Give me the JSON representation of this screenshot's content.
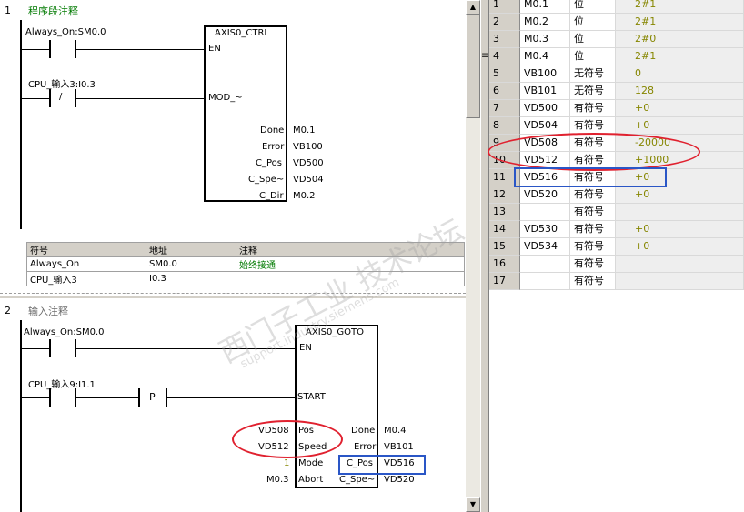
{
  "network1": {
    "number": "1",
    "comment": "程序段注释",
    "contact1_label": "Always_On:SM0.0",
    "contact2_label": "CPU_输入3:I0.3",
    "contact2_symbol": "/",
    "block_title": "AXIS0_CTRL",
    "in_en": "EN",
    "in_mod": "MOD_~",
    "outputs": [
      {
        "pin": "Done",
        "addr": "M0.1"
      },
      {
        "pin": "Error",
        "addr": "VB100"
      },
      {
        "pin": "C_Pos",
        "addr": "VD500"
      },
      {
        "pin": "C_Spe~",
        "addr": "VD504"
      },
      {
        "pin": "C_Dir",
        "addr": "M0.2"
      }
    ],
    "symbol_table": {
      "headers": [
        "符号",
        "地址",
        "注释"
      ],
      "rows": [
        [
          "Always_On",
          "SM0.0",
          "始终接通"
        ],
        [
          "CPU_输入3",
          "I0.3",
          ""
        ]
      ]
    }
  },
  "network2": {
    "number": "2",
    "comment": "输入注释",
    "contact1_label": "Always_On:SM0.0",
    "contact2_label": "CPU_输入9:I1.1",
    "edge_symbol": "P",
    "block_title": "AXIS0_GOTO",
    "in_en": "EN",
    "in_start": "START",
    "inputs": [
      {
        "addr": "VD508",
        "pin": "Pos"
      },
      {
        "addr": "VD512",
        "pin": "Speed"
      },
      {
        "addr": "1",
        "pin": "Mode"
      },
      {
        "addr": "M0.3",
        "pin": "Abort"
      }
    ],
    "outputs": [
      {
        "pin": "Done",
        "addr": "M0.4"
      },
      {
        "pin": "Error",
        "addr": "VB101"
      },
      {
        "pin": "C_Pos",
        "addr": "VD516"
      },
      {
        "pin": "C_Spe~",
        "addr": "VD520"
      }
    ]
  },
  "scrollbar": {
    "up": "▲",
    "down": "▼",
    "grip": "≡"
  },
  "status_chart": {
    "rows": [
      {
        "n": "1",
        "addr": "M0.1",
        "fmt": "位",
        "val": "2#1"
      },
      {
        "n": "2",
        "addr": "M0.2",
        "fmt": "位",
        "val": "2#1"
      },
      {
        "n": "3",
        "addr": "M0.3",
        "fmt": "位",
        "val": "2#0"
      },
      {
        "n": "4",
        "addr": "M0.4",
        "fmt": "位",
        "val": "2#1"
      },
      {
        "n": "5",
        "addr": "VB100",
        "fmt": "无符号",
        "val": "0"
      },
      {
        "n": "6",
        "addr": "VB101",
        "fmt": "无符号",
        "val": "128"
      },
      {
        "n": "7",
        "addr": "VD500",
        "fmt": "有符号",
        "val": "+0"
      },
      {
        "n": "8",
        "addr": "VD504",
        "fmt": "有符号",
        "val": "+0"
      },
      {
        "n": "9",
        "addr": "VD508",
        "fmt": "有符号",
        "val": "-20000"
      },
      {
        "n": "10",
        "addr": "VD512",
        "fmt": "有符号",
        "val": "+1000"
      },
      {
        "n": "11",
        "addr": "VD516",
        "fmt": "有符号",
        "val": "+0"
      },
      {
        "n": "12",
        "addr": "VD520",
        "fmt": "有符号",
        "val": "+0"
      },
      {
        "n": "13",
        "addr": "",
        "fmt": "有符号",
        "val": ""
      },
      {
        "n": "14",
        "addr": "VD530",
        "fmt": "有符号",
        "val": "+0"
      },
      {
        "n": "15",
        "addr": "VD534",
        "fmt": "有符号",
        "val": "+0"
      },
      {
        "n": "16",
        "addr": "",
        "fmt": "有符号",
        "val": ""
      },
      {
        "n": "17",
        "addr": "",
        "fmt": "有符号",
        "val": ""
      }
    ]
  },
  "watermark": {
    "main": "西门子工业 技术论坛",
    "sub": "support.industry.siemens.com"
  },
  "colors": {
    "annotation_red": "#e0212f",
    "annotation_blue": "#2a56c6",
    "comment_green": "#007a00",
    "value_olive": "#868600"
  }
}
